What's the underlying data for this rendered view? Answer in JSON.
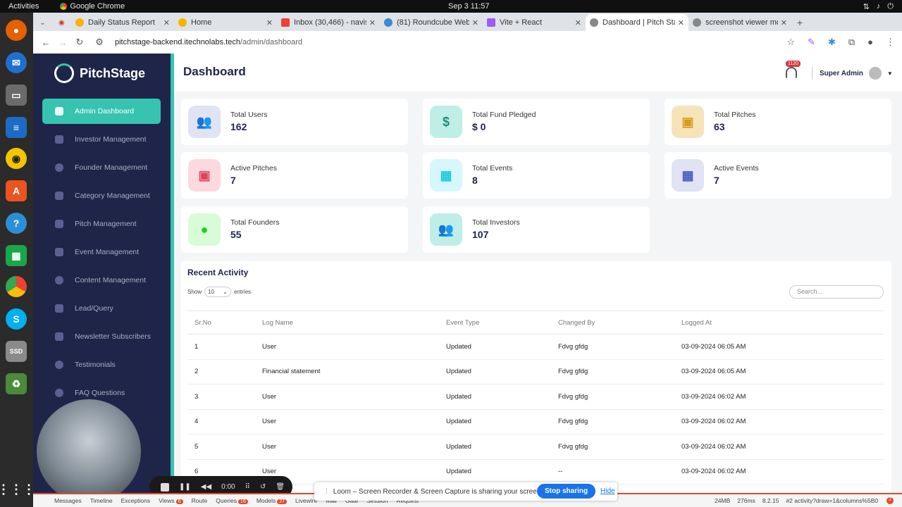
{
  "os": {
    "activities": "Activities",
    "app_name": "Google Chrome",
    "clock": "Sep 3  11:57"
  },
  "browser": {
    "tabs": [
      {
        "label": "Daily Status Report",
        "active": false
      },
      {
        "label": "Home",
        "active": false
      },
      {
        "label": "Inbox (30,466) - navisi",
        "active": false
      },
      {
        "label": "(81) Roundcube Webm",
        "active": false
      },
      {
        "label": "Vite + React",
        "active": false
      },
      {
        "label": "Dashboard | Pitch Stag",
        "active": true
      },
      {
        "label": "screenshot viewer mo",
        "active": false
      }
    ],
    "url_host": "pitchstage-backend.itechnolabs.tech",
    "url_path": "/admin/dashboard"
  },
  "sidebar": {
    "brand": "PitchStage",
    "items": [
      {
        "label": "Admin Dashboard",
        "active": true
      },
      {
        "label": "Investor Management"
      },
      {
        "label": "Founder Management"
      },
      {
        "label": "Category Management"
      },
      {
        "label": "Pitch Management"
      },
      {
        "label": "Event Management"
      },
      {
        "label": "Content Management"
      },
      {
        "label": "Lead/Query"
      },
      {
        "label": "Newsletter Subscribers"
      },
      {
        "label": "Testimonials"
      },
      {
        "label": "FAQ Questions"
      }
    ]
  },
  "header": {
    "title": "Dashboard",
    "notif_count": "1120",
    "user": "Super Admin"
  },
  "cards": [
    {
      "label": "Total Users",
      "value": "162",
      "icon": "users-icon",
      "bg": "#dfe3f3",
      "fg": "#4a5bc4"
    },
    {
      "label": "Total Fund Pledged",
      "value": "$ 0",
      "icon": "dollar-icon",
      "bg": "#bfeee6",
      "fg": "#1f8e7c"
    },
    {
      "label": "Total Pitches",
      "value": "63",
      "icon": "presentation-icon",
      "bg": "#f6e4b8",
      "fg": "#d99a18"
    },
    {
      "label": "Active Pitches",
      "value": "7",
      "icon": "presentation-icon",
      "bg": "#fbd9df",
      "fg": "#e0435a"
    },
    {
      "label": "Total Events",
      "value": "8",
      "icon": "calendar-icon",
      "bg": "#d6f7fb",
      "fg": "#22c8de"
    },
    {
      "label": "Active Events",
      "value": "7",
      "icon": "calendar-icon",
      "bg": "#dfe3f3",
      "fg": "#4a5bc4"
    },
    {
      "label": "Total Founders",
      "value": "55",
      "icon": "lightbulb-icon",
      "bg": "#d8fbd8",
      "fg": "#1fd11f"
    },
    {
      "label": "Total Investors",
      "value": "107",
      "icon": "users-icon",
      "bg": "#bfeee6",
      "fg": "#1f8e7c"
    }
  ],
  "activity": {
    "title": "Recent Activity",
    "show_label": "Show",
    "entries_value": "10",
    "entries_label": "entries",
    "search_placeholder": "Search...",
    "columns": [
      "Sr.No",
      "Log Name",
      "Event Type",
      "Changed By",
      "Logged At"
    ],
    "rows": [
      [
        "1",
        "User",
        "Updated",
        "Fdvg gfdg",
        "03-09-2024 06:05 AM"
      ],
      [
        "2",
        "Financial statement",
        "Updated",
        "Fdvg gfdg",
        "03-09-2024 06:05 AM"
      ],
      [
        "3",
        "User",
        "Updated",
        "Fdvg gfdg",
        "03-09-2024 06:02 AM"
      ],
      [
        "4",
        "User",
        "Updated",
        "Fdvg gfdg",
        "03-09-2024 06:02 AM"
      ],
      [
        "5",
        "User",
        "Updated",
        "Fdvg gfdg",
        "03-09-2024 06:02 AM"
      ],
      [
        "6",
        "User",
        "Updated",
        "--",
        "03-09-2024 06:02 AM"
      ]
    ]
  },
  "recorder": {
    "time": "0:00",
    "share_text": "Loom – Screen Recorder & Screen Capture is sharing your screen.",
    "stop_label": "Stop sharing",
    "hide_label": "Hide"
  },
  "debugbar": {
    "items": [
      "Messages",
      "Timeline",
      "Exceptions",
      "Views",
      "Route",
      "Queries",
      "Models",
      "Livewire",
      "Mail",
      "Gate",
      "Session",
      "Request"
    ],
    "views_count": "6",
    "queries_count": "16",
    "models_count": "27",
    "memory": "24MB",
    "duration": "276ms",
    "php": "8.2.15",
    "request": "#2 activity?draw=1&columns%5B0",
    "errors": "2"
  }
}
